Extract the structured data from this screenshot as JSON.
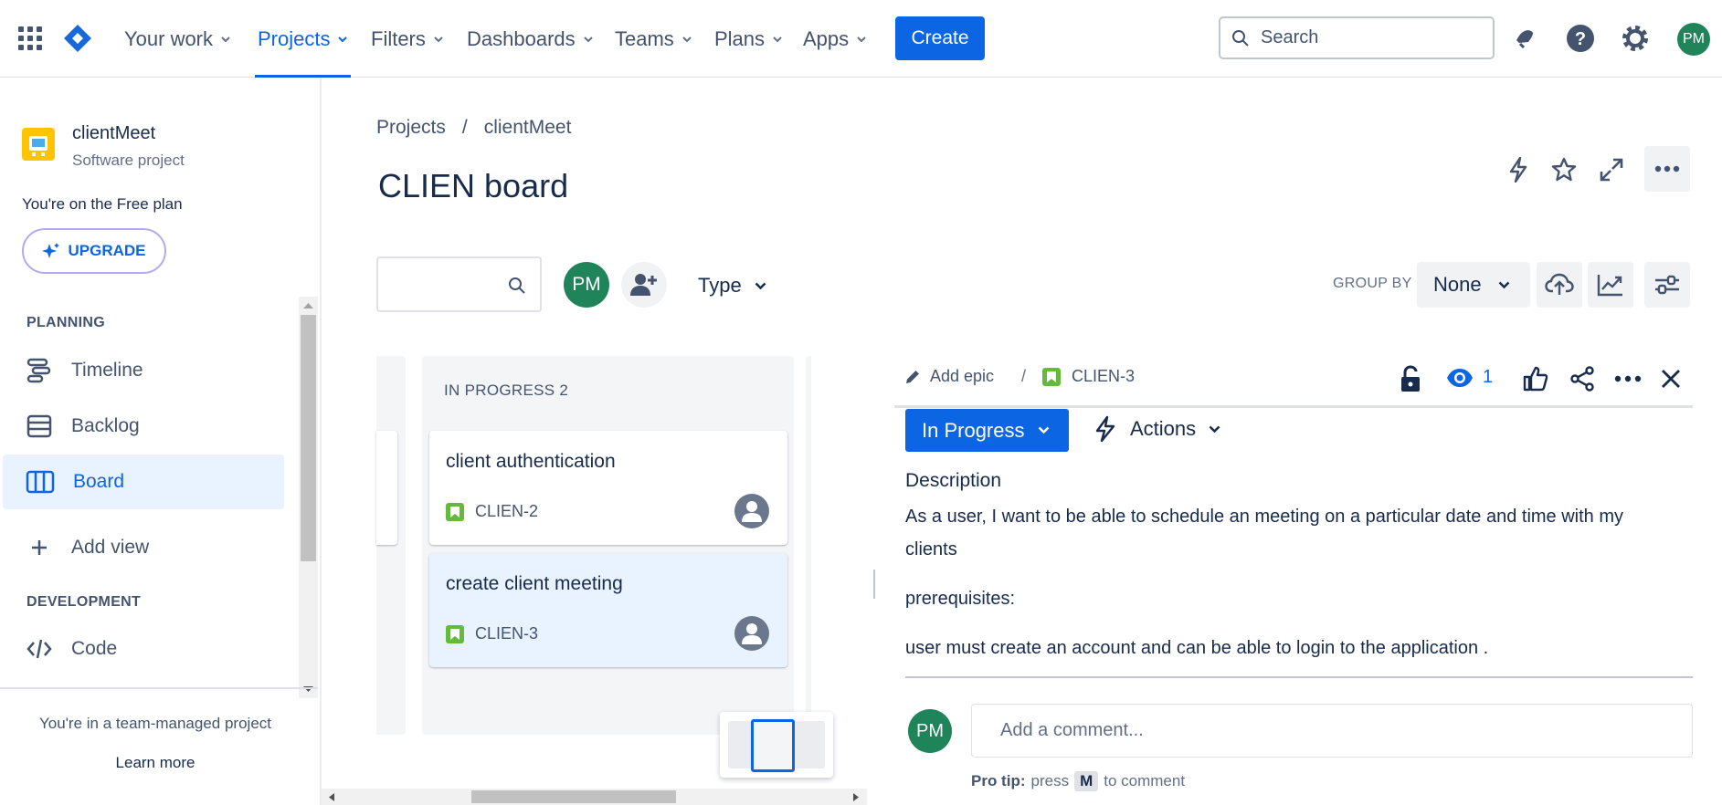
{
  "topnav": {
    "items": [
      {
        "label": "Your work"
      },
      {
        "label": "Projects"
      },
      {
        "label": "Filters"
      },
      {
        "label": "Dashboards"
      },
      {
        "label": "Teams"
      },
      {
        "label": "Plans"
      },
      {
        "label": "Apps"
      }
    ],
    "active_item": "Projects",
    "create_label": "Create",
    "search_placeholder": "Search",
    "user_initials": "PM",
    "accent_color": "#0c66e4"
  },
  "sidebar": {
    "project_name": "clientMeet",
    "project_type": "Software project",
    "plan_text": "You're on the Free plan",
    "upgrade_label": "UPGRADE",
    "planning_heading": "PLANNING",
    "planning_items": [
      {
        "label": "Timeline",
        "icon": "timeline-icon"
      },
      {
        "label": "Backlog",
        "icon": "backlog-icon"
      },
      {
        "label": "Board",
        "icon": "board-icon"
      }
    ],
    "add_view_label": "Add view",
    "development_heading": "DEVELOPMENT",
    "code_label": "Code",
    "footer_text": "You're in a team-managed project",
    "learn_more": "Learn more"
  },
  "main": {
    "breadcrumb": {
      "root": "Projects",
      "separator": "/",
      "project": "clientMeet"
    },
    "title": "CLIEN board",
    "filter_avatar_initials": "PM",
    "type_filter_label": "Type",
    "group_by_label": "GROUP BY",
    "group_by_value": "None"
  },
  "board": {
    "column_title": "IN PROGRESS 2",
    "cards": [
      {
        "title": "client authentication",
        "key": "CLIEN-2"
      },
      {
        "title": "create client meeting",
        "key": "CLIEN-3"
      }
    ]
  },
  "issue": {
    "add_epic": "Add epic",
    "separator": "/",
    "key": "CLIEN-3",
    "watch_count": "1",
    "status": "In Progress",
    "actions_label": "Actions",
    "description_heading": "Description",
    "description_line1": "As a user, I want to be able to schedule an meeting on a particular date and time with my",
    "description_line2": "clients",
    "prereq_label": "prerequisites:",
    "prereq_text": "user must create an account and can be able to login to the application .",
    "comment_avatar_initials": "PM",
    "comment_placeholder": "Add a comment...",
    "pro_tip_label": "Pro tip:",
    "pro_tip_press": "press",
    "pro_tip_key": "M",
    "pro_tip_suffix": "to comment"
  }
}
